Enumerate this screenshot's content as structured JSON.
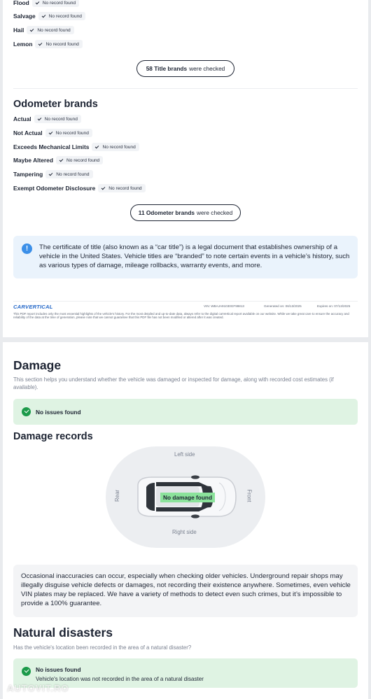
{
  "title_brands": {
    "items": [
      {
        "label": "Flood",
        "status": "No record found"
      },
      {
        "label": "Salvage",
        "status": "No record found"
      },
      {
        "label": "Hail",
        "status": "No record found"
      },
      {
        "label": "Lemon",
        "status": "No record found"
      }
    ],
    "checked_count": "58 Title brands",
    "checked_suffix": "were checked"
  },
  "odometer_brands": {
    "heading": "Odometer brands",
    "items": [
      {
        "label": "Actual",
        "status": "No record found"
      },
      {
        "label": "Not Actual",
        "status": "No record found"
      },
      {
        "label": "Exceeds Mechanical Limits",
        "status": "No record found"
      },
      {
        "label": "Maybe Altered",
        "status": "No record found"
      },
      {
        "label": "Tampering",
        "status": "No record found"
      },
      {
        "label": "Exempt Odometer Disclosure",
        "status": "No record found"
      }
    ],
    "checked_count": "11 Odometer brands",
    "checked_suffix": "were checked"
  },
  "info_box": {
    "icon": "info-icon",
    "text": "The certificate of title (also known as a “car title”) is a legal document that establishes ownership of a vehicle in the United States. Vehicle titles are “branded” to note certain events in a vehicle’s history, such as various types of damage, mileage rollbacks, warranty events, and more."
  },
  "footer": {
    "logo": "CARVERTICAL",
    "vin": "VIN: WBAJA91030GF99813",
    "generated": "Generated on: 06/13/2025",
    "expires": "Expires on: 07/13/2025",
    "disclaimer": "This PDF report includes only the most essential highlights of the vehicle's history. For the most detailed and up-to-date data, always refer to the digital carVertical report available on our website. While we take great care to ensure the accuracy and reliability of the data at the time of generation, please note that we cannot guarantee that this PDF file has not been modified or altered after it was created."
  },
  "damage": {
    "heading": "Damage",
    "description": "This section helps you understand whether the vehicle was damaged or inspected for damage, along with recorded cost estimates (if available).",
    "status": "No issues found",
    "records_heading": "Damage records",
    "diagram": {
      "left_side": "Left side",
      "right_side": "Right side",
      "rear": "Rear",
      "front": "Front",
      "badge": "No damage found"
    },
    "note": "Occasional inaccuracies can occur, especially when checking older vehicles. Underground repair shops may illegally disguise vehicle defects or damages, not recording their existence anywhere. Sometimes, even vehicle VIN plates may be replaced. We have a variety of methods to detect even such crimes, but it’s impossible to provide a 100% guarantee."
  },
  "natural_disasters": {
    "heading": "Natural disasters",
    "question": "Has the vehicle's location been recorded in the area of a natural disaster?",
    "status": "No issues found",
    "detail": "Vehicle's location was not recorded in the area of a natural disaster"
  },
  "watermark": "AUTOVIT.RO",
  "colors": {
    "accent_blue": "#2367c8",
    "success_green": "#1c9a4a",
    "success_bg": "#dff3e3",
    "info_bg": "#eaf3fc"
  }
}
